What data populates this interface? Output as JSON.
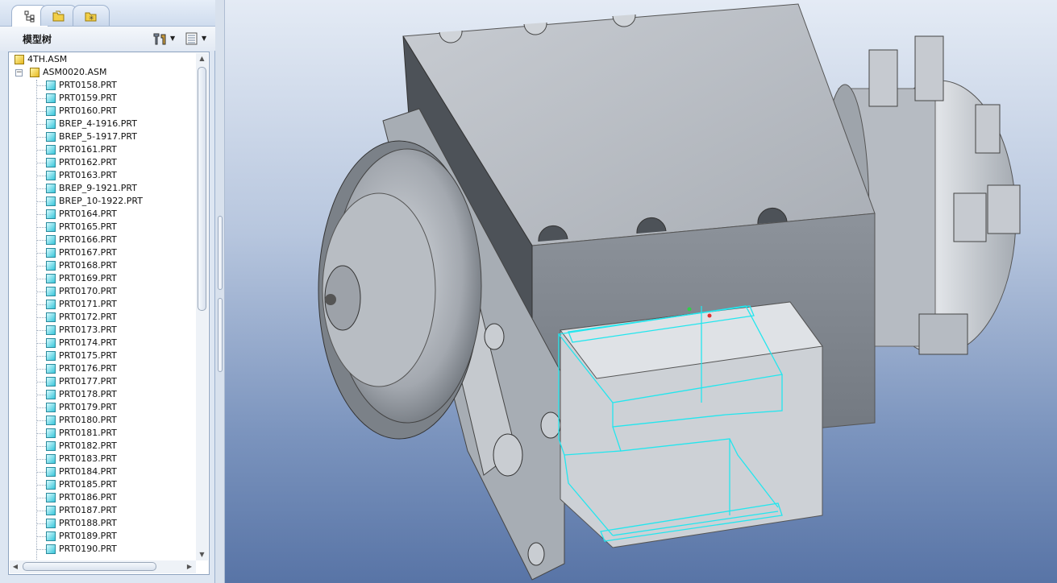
{
  "tabs": [
    {
      "name": "model-tree",
      "icon": "model-tree-icon"
    },
    {
      "name": "folder-browser",
      "icon": "folder-browser-icon"
    },
    {
      "name": "favorites",
      "icon": "favorites-icon"
    }
  ],
  "panel": {
    "title": "模型树",
    "settings_icon": "settings-icon",
    "show_icon": "show-columns-icon"
  },
  "tree": {
    "root": "4TH.ASM",
    "subassembly": "ASM0020.ASM",
    "parts": [
      "PRT0158.PRT",
      "PRT0159.PRT",
      "PRT0160.PRT",
      "BREP_4-1916.PRT",
      "BREP_5-1917.PRT",
      "PRT0161.PRT",
      "PRT0162.PRT",
      "PRT0163.PRT",
      "BREP_9-1921.PRT",
      "BREP_10-1922.PRT",
      "PRT0164.PRT",
      "PRT0165.PRT",
      "PRT0166.PRT",
      "PRT0167.PRT",
      "PRT0168.PRT",
      "PRT0169.PRT",
      "PRT0170.PRT",
      "PRT0171.PRT",
      "PRT0172.PRT",
      "PRT0173.PRT",
      "PRT0174.PRT",
      "PRT0175.PRT",
      "PRT0176.PRT",
      "PRT0177.PRT",
      "PRT0178.PRT",
      "PRT0179.PRT",
      "PRT0180.PRT",
      "PRT0181.PRT",
      "PRT0182.PRT",
      "PRT0183.PRT",
      "PRT0184.PRT",
      "PRT0185.PRT",
      "PRT0186.PRT",
      "PRT0187.PRT",
      "PRT0188.PRT",
      "PRT0189.PRT",
      "PRT0190.PRT"
    ]
  },
  "colors": {
    "viewport_top": "#e4ebf5",
    "viewport_bottom": "#5874a6",
    "model_gray": "#b4b9c0",
    "selection_highlight": "#22e6ee"
  }
}
